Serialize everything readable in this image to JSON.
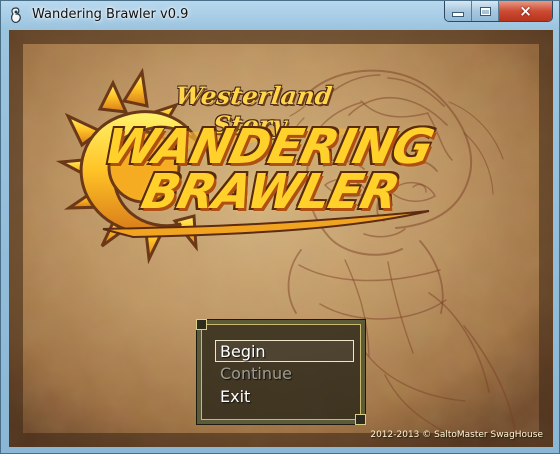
{
  "window": {
    "title": "Wandering Brawler v0.9",
    "icons": {
      "app": "game-controller-icon",
      "minimize": "minimize-icon",
      "maximize": "maximize-icon",
      "close": "close-icon"
    }
  },
  "title_screen": {
    "subtitle": "Westerland Story",
    "logo_line_1": "WANDERING",
    "logo_line_2": "BRAWLER",
    "menu": {
      "begin": "Begin",
      "continue": "Continue",
      "exit": "Exit"
    },
    "copyright": "2012-2013 © SaltoMaster SwagHouse"
  },
  "colors": {
    "parchment": "#c19a67",
    "logo_gold": "#ffd12a",
    "menu_background": "#2a2618",
    "disabled_text": "#9d9a8f"
  }
}
